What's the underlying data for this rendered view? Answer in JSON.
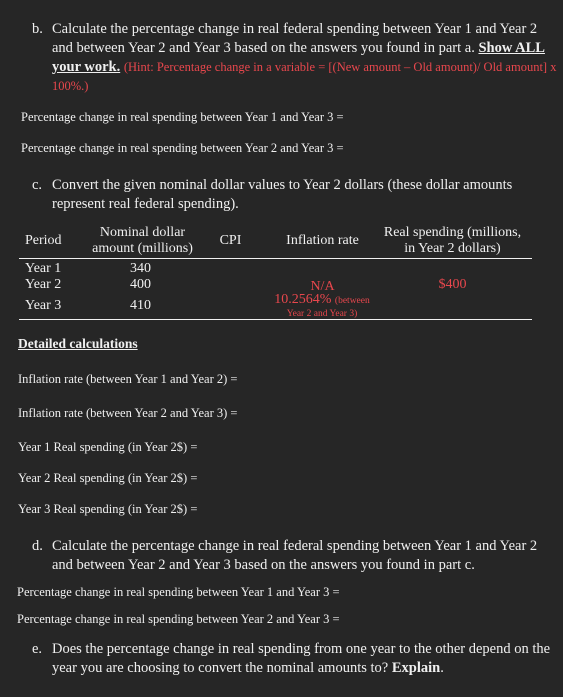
{
  "part_b": {
    "label": "b.",
    "text_line1": "Calculate the percentage change in real federal spending between Year 1 and Year 2",
    "text_line2": "and between Year 2 and Year 3 based on the answers you found in part a.",
    "emphasis": "Show ALL your work.",
    "emphasis_1": "Show ALL",
    "emphasis_2": "your work.",
    "hint": "(Hint: Percentage change in a variable = [(New amount – Old amount)/ Old amount] x",
    "hint_end": "100%.)",
    "answer_1": "Percentage change in real spending between Year 1 and Year 3 =",
    "answer_2": "Percentage change in real spending between Year 2 and Year 3 ="
  },
  "part_c": {
    "label": "c.",
    "text_line1": "Convert the given nominal dollar values to Year 2 dollars (these dollar amounts",
    "text_line2": "represent real federal spending)."
  },
  "table": {
    "headers": {
      "period": "Period",
      "nominal_1": "Nominal dollar",
      "nominal_2": "amount (millions)",
      "cpi": "CPI",
      "inflation": "Inflation rate",
      "real_1": "Real spending (millions,",
      "real_2": "in Year 2 dollars)"
    },
    "rows": [
      {
        "period": "Year 1",
        "nominal": "340",
        "cpi": "",
        "inflation": "",
        "real": ""
      },
      {
        "period": "Year 2",
        "nominal": "400",
        "cpi": "",
        "inflation": "N/A",
        "real": "$400"
      },
      {
        "period": "Year 3",
        "nominal": "410",
        "cpi": "",
        "inflation": "10.2564%",
        "inflation_note_1": "(between",
        "inflation_note_2": "Year 2 and Year 3)",
        "real": ""
      }
    ]
  },
  "calculations": {
    "heading": "Detailed calculations",
    "items": [
      "Inflation rate (between Year 1 and Year 2) =",
      "Inflation rate (between Year 2 and Year 3) =",
      "Year 1 Real spending (in Year 2$) =",
      "Year 2 Real spending (in Year 2$) =",
      "Year 3 Real spending (in Year 2$) ="
    ]
  },
  "part_d": {
    "label": "d.",
    "text_line1": "Calculate the percentage change in real federal spending between Year 1 and Year 2",
    "text_line2": "and between Year 2 and Year 3 based on the answers you found in part c.",
    "answer_1": "Percentage change in real spending between Year 1 and Year 3 =",
    "answer_2": "Percentage change in real spending between Year 2 and Year 3 ="
  },
  "part_e": {
    "label": "e.",
    "text_line1": "Does the percentage change in real spending from one year to the other depend on the",
    "text_line2": "year you are choosing to convert the nominal amounts to?",
    "emphasis": "Explain",
    "end": "."
  },
  "colors": {
    "background": "#262626",
    "text": "#f0f0f0",
    "answer_red": "#e8474d"
  }
}
